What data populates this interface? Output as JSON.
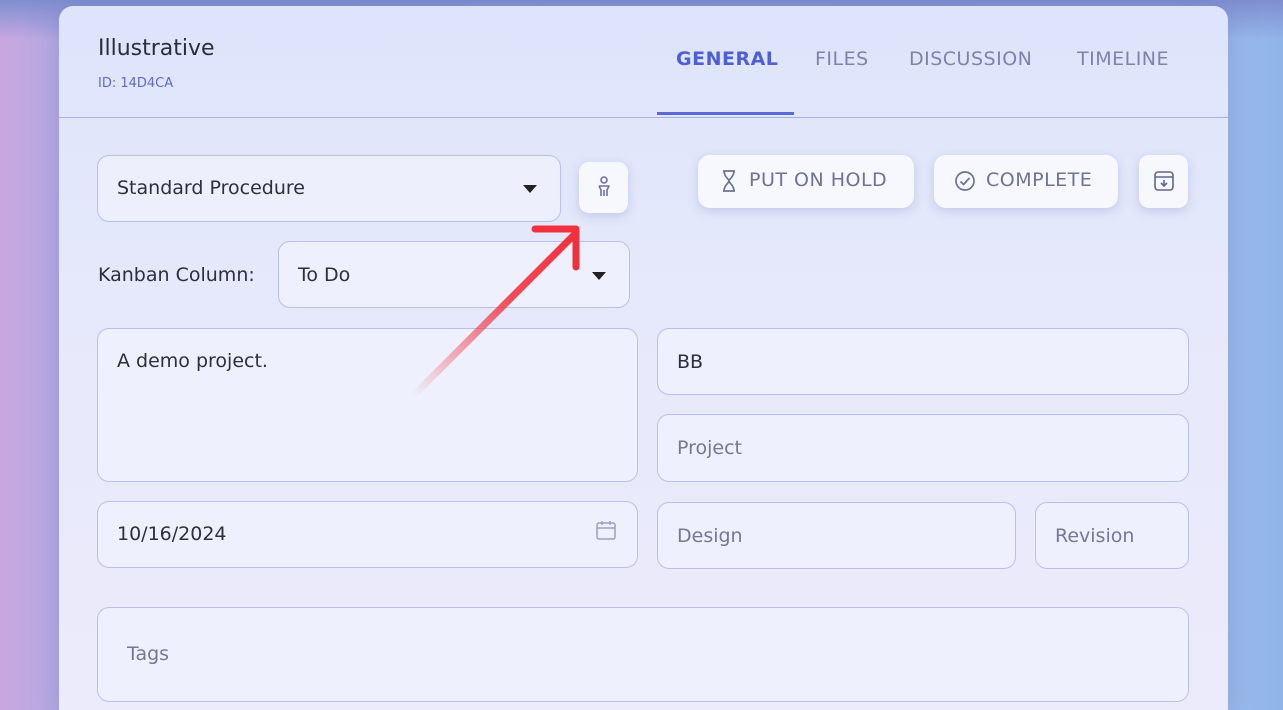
{
  "project": {
    "title": "Illustrative",
    "id_text": "ID: 14D4CA"
  },
  "tabs": [
    {
      "label": "GENERAL",
      "active": true
    },
    {
      "label": "FILES",
      "active": false
    },
    {
      "label": "DISCUSSION",
      "active": false
    },
    {
      "label": "TIMELINE",
      "active": false
    }
  ],
  "form": {
    "procedure_select": "Standard Procedure",
    "kanban_label": "Kanban Column:",
    "kanban_select": "To Do",
    "description": "A demo project.",
    "owner": "BB",
    "type_placeholder": "Project",
    "date": "10/16/2024",
    "phase_placeholder": "Design",
    "revision_placeholder": "Revision",
    "tags_placeholder": "Tags"
  },
  "actions": {
    "hold_label": "PUT ON HOLD",
    "complete_label": "COMPLETE"
  },
  "icons": {
    "assign": "person-icon",
    "hold": "hourglass-icon",
    "complete": "check-circle-icon",
    "archive": "archive-download-icon",
    "calendar": "calendar-icon"
  },
  "colors": {
    "accent": "#4e5fd6",
    "annotation_arrow": "#f0303c"
  }
}
